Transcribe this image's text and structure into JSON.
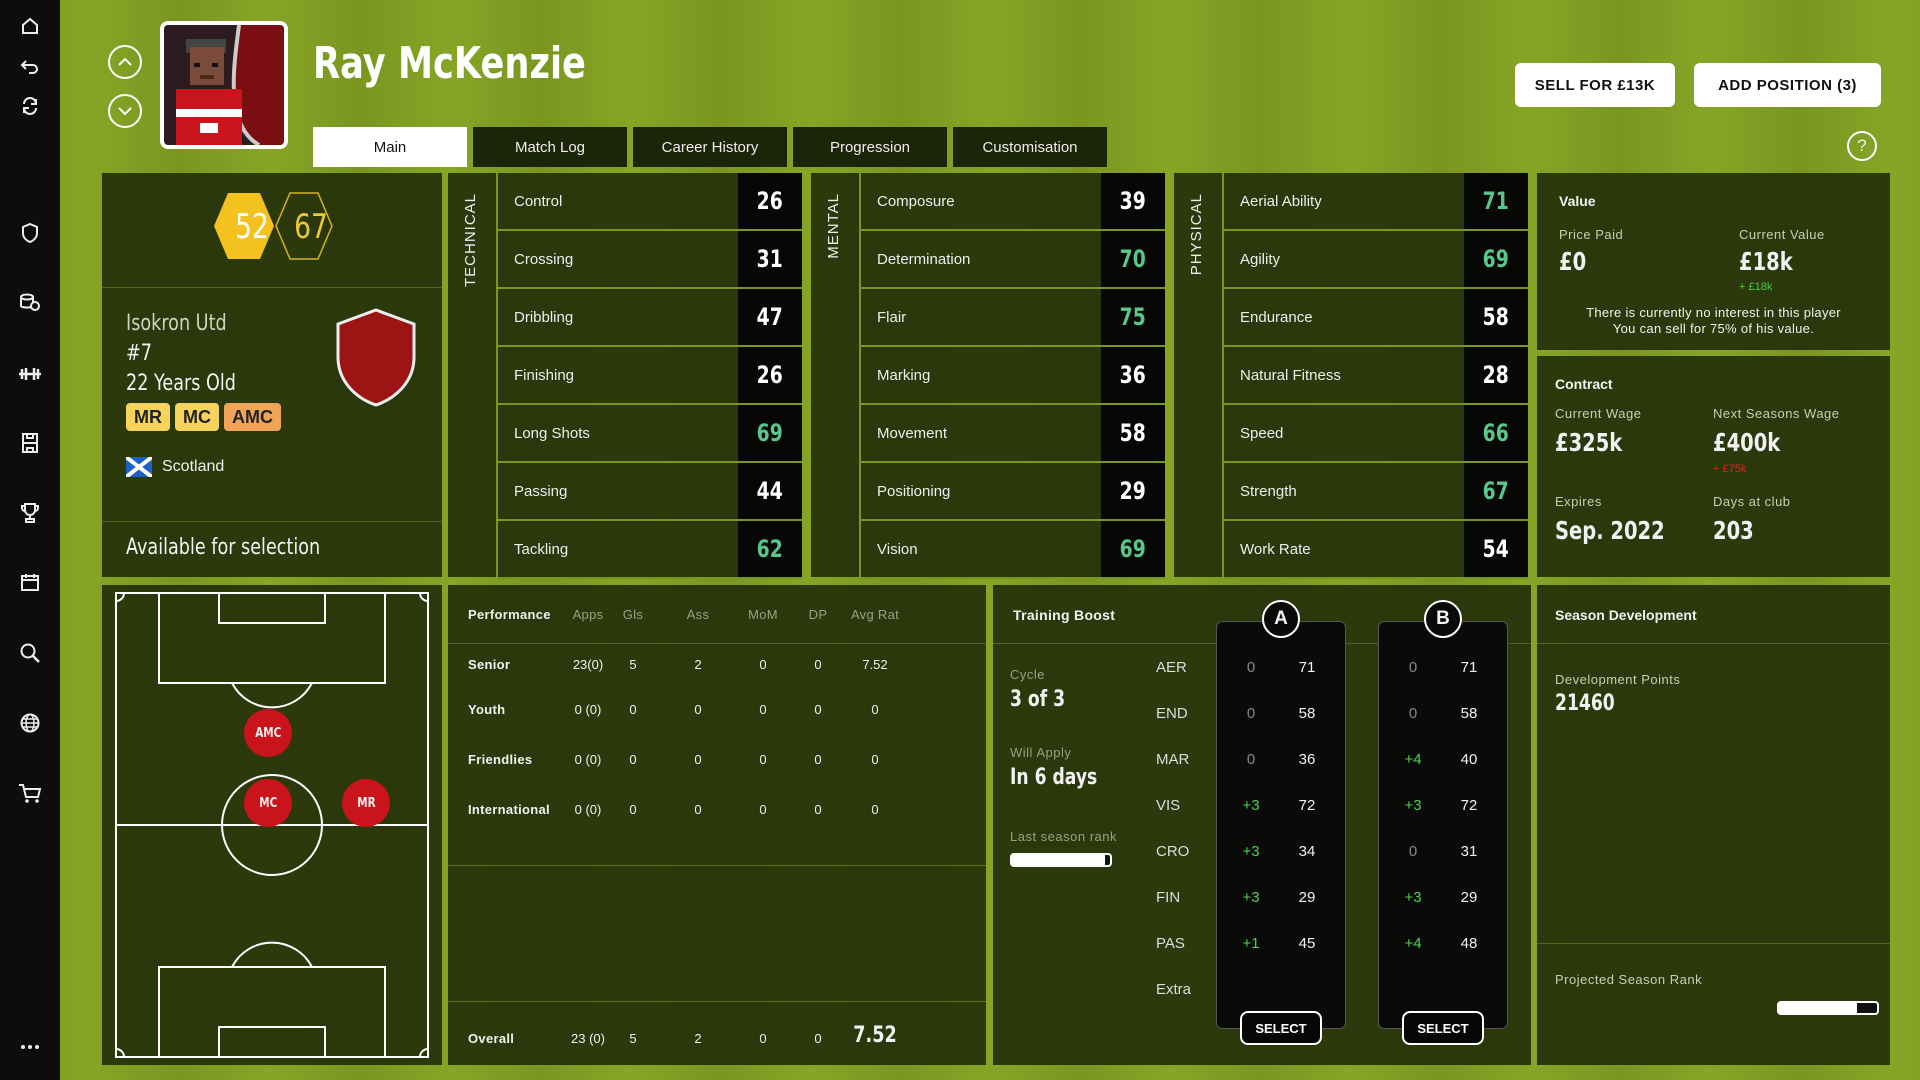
{
  "rail": [
    "home-icon",
    "back-icon",
    "refresh-icon",
    "shield-icon",
    "finance-icon",
    "training-icon",
    "tactics-icon",
    "trophy-icon",
    "calendar-icon",
    "search-icon",
    "globe-icon",
    "cart-icon",
    "more-icon"
  ],
  "player": {
    "name": "Ray McKenzie",
    "rating_current": "52",
    "rating_potential": "67",
    "club": "Isokron Utd",
    "number": "#7",
    "age": "22 Years Old",
    "positions": [
      "MR",
      "MC",
      "AMC"
    ],
    "nationality": "Scotland",
    "availability": "Available for selection"
  },
  "header_buttons": {
    "sell": "SELL FOR £13K",
    "add_position": "ADD POSITION (3)",
    "help": "?"
  },
  "tabs": [
    "Main",
    "Match Log",
    "Career History",
    "Progression",
    "Customisation"
  ],
  "technical": {
    "title": "TECHNICAL",
    "rows": [
      {
        "label": "Control",
        "value": "26",
        "color": "#ffffff"
      },
      {
        "label": "Crossing",
        "value": "31",
        "color": "#ffffff"
      },
      {
        "label": "Dribbling",
        "value": "47",
        "color": "#ffffff"
      },
      {
        "label": "Finishing",
        "value": "26",
        "color": "#ffffff"
      },
      {
        "label": "Long Shots",
        "value": "69",
        "color": "#59c78a"
      },
      {
        "label": "Passing",
        "value": "44",
        "color": "#ffffff"
      },
      {
        "label": "Tackling",
        "value": "62",
        "color": "#59c78a"
      }
    ]
  },
  "mental": {
    "title": "MENTAL",
    "rows": [
      {
        "label": "Composure",
        "value": "39",
        "color": "#ffffff"
      },
      {
        "label": "Determination",
        "value": "70",
        "color": "#59c78a"
      },
      {
        "label": "Flair",
        "value": "75",
        "color": "#59c78a"
      },
      {
        "label": "Marking",
        "value": "36",
        "color": "#ffffff"
      },
      {
        "label": "Movement",
        "value": "58",
        "color": "#ffffff"
      },
      {
        "label": "Positioning",
        "value": "29",
        "color": "#ffffff"
      },
      {
        "label": "Vision",
        "value": "69",
        "color": "#59c78a"
      }
    ]
  },
  "physical": {
    "title": "PHYSICAL",
    "rows": [
      {
        "label": "Aerial Ability",
        "value": "71",
        "color": "#59c78a"
      },
      {
        "label": "Agility",
        "value": "69",
        "color": "#59c78a"
      },
      {
        "label": "Endurance",
        "value": "58",
        "color": "#ffffff"
      },
      {
        "label": "Natural Fitness",
        "value": "28",
        "color": "#ffffff"
      },
      {
        "label": "Speed",
        "value": "66",
        "color": "#59c78a"
      },
      {
        "label": "Strength",
        "value": "67",
        "color": "#59c78a"
      },
      {
        "label": "Work Rate",
        "value": "54",
        "color": "#ffffff"
      }
    ]
  },
  "value": {
    "title": "Value",
    "price_paid_label": "Price Paid",
    "price_paid": "£0",
    "current_value_label": "Current Value",
    "current_value": "£18k",
    "current_value_delta": "+ £18k",
    "note_line1": "There is currently no interest in this player",
    "note_line2": "You can sell for 75% of his value."
  },
  "contract": {
    "title": "Contract",
    "current_wage_label": "Current Wage",
    "current_wage": "£325k",
    "next_wage_label": "Next Seasons Wage",
    "next_wage": "£400k",
    "next_wage_delta": "+ £75k",
    "expires_label": "Expires",
    "expires": "Sep. 2022",
    "days_label": "Days at club",
    "days": "203"
  },
  "pitch_markers": [
    "AMC",
    "MC",
    "MR"
  ],
  "performance": {
    "headers": [
      "Performance",
      "Apps",
      "Gls",
      "Ass",
      "MoM",
      "DP",
      "Avg Rat"
    ],
    "rows": [
      [
        "Senior",
        "23(0)",
        "5",
        "2",
        "0",
        "0",
        "7.52"
      ],
      [
        "Youth",
        "0 (0)",
        "0",
        "0",
        "0",
        "0",
        "0"
      ],
      [
        "Friendlies",
        "0 (0)",
        "0",
        "0",
        "0",
        "0",
        "0"
      ],
      [
        "International",
        "0 (0)",
        "0",
        "0",
        "0",
        "0",
        "0"
      ]
    ],
    "overall": [
      "Overall",
      "23 (0)",
      "5",
      "2",
      "0",
      "0",
      "7.52"
    ]
  },
  "training": {
    "title": "Training Boost",
    "cycle_label": "Cycle",
    "cycle": "3 of 3",
    "will_apply_label": "Will Apply",
    "will_apply": "In 6 days",
    "last_rank_label": "Last season rank",
    "last_rank_fill": 0.95,
    "stats": [
      "AER",
      "END",
      "MAR",
      "VIS",
      "CRO",
      "FIN",
      "PAS",
      "Extra"
    ],
    "a": {
      "label": "A",
      "boost": [
        "0",
        "0",
        "0",
        "+3",
        "+3",
        "+3",
        "+1",
        ""
      ],
      "values": [
        "71",
        "58",
        "36",
        "72",
        "34",
        "29",
        "45",
        ""
      ],
      "select": "SELECT"
    },
    "b": {
      "label": "B",
      "boost": [
        "0",
        "0",
        "+4",
        "+3",
        "0",
        "+3",
        "+4",
        ""
      ],
      "values": [
        "71",
        "58",
        "40",
        "72",
        "31",
        "29",
        "48",
        ""
      ],
      "select": "SELECT"
    }
  },
  "season_dev": {
    "title": "Season Development",
    "points_label": "Development Points",
    "points": "21460",
    "projected_label": "Projected Season Rank",
    "projected_fill": 0.8
  }
}
